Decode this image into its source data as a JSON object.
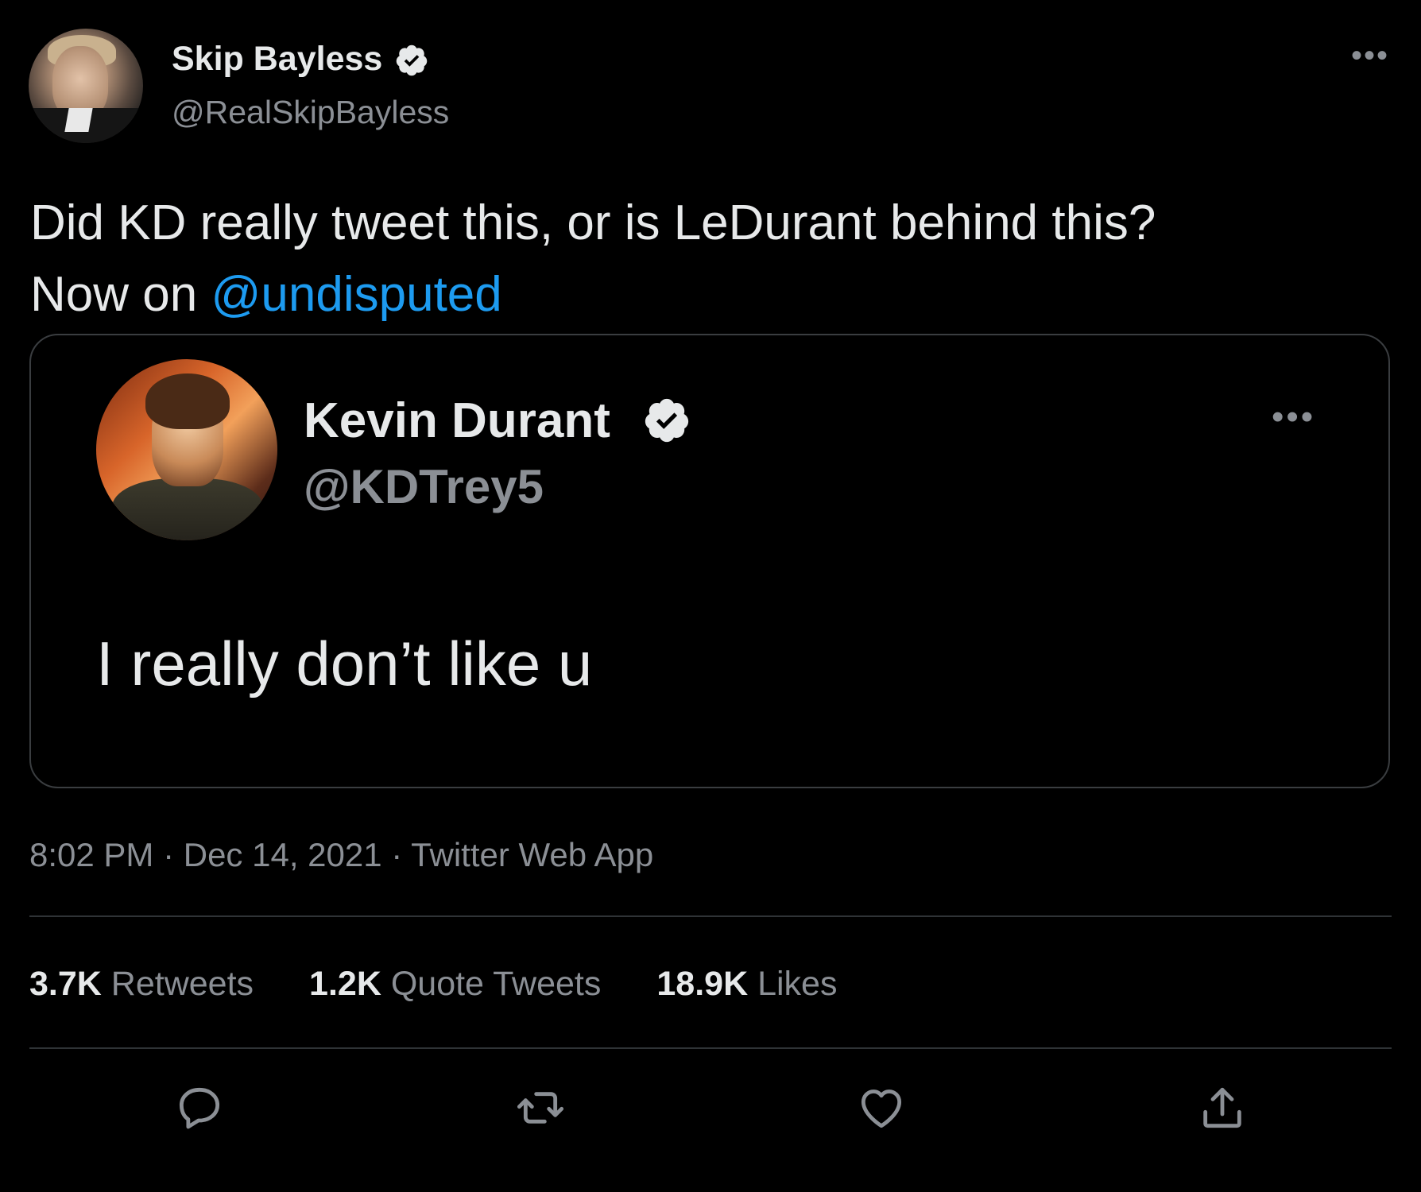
{
  "tweet": {
    "author": {
      "name": "Skip Bayless",
      "handle": "@RealSkipBayless"
    },
    "more_label": "•••",
    "text_line1": "Did KD really tweet this, or is LeDurant behind this?",
    "text_line2_prefix": "Now on ",
    "mention": "@undisputed",
    "meta": "8:02 PM · Dec 14, 2021 · Twitter Web App"
  },
  "quote": {
    "author": {
      "name": "Kevin Durant",
      "handle": "@KDTrey5"
    },
    "more_label": "•••",
    "text": "I really don’t like u"
  },
  "stats": {
    "retweets_count": "3.7K",
    "retweets_label": " Retweets",
    "quotes_count": "1.2K",
    "quotes_label": " Quote Tweets",
    "likes_count": "18.9K",
    "likes_label": " Likes"
  },
  "actions": {
    "reply": "reply-icon",
    "retweet": "retweet-icon",
    "like": "heart-icon",
    "share": "share-icon"
  },
  "colors": {
    "background": "#000000",
    "text": "#e7e9ea",
    "secondary": "#8b8f95",
    "link": "#1d9bf0",
    "border": "#2f3336"
  }
}
